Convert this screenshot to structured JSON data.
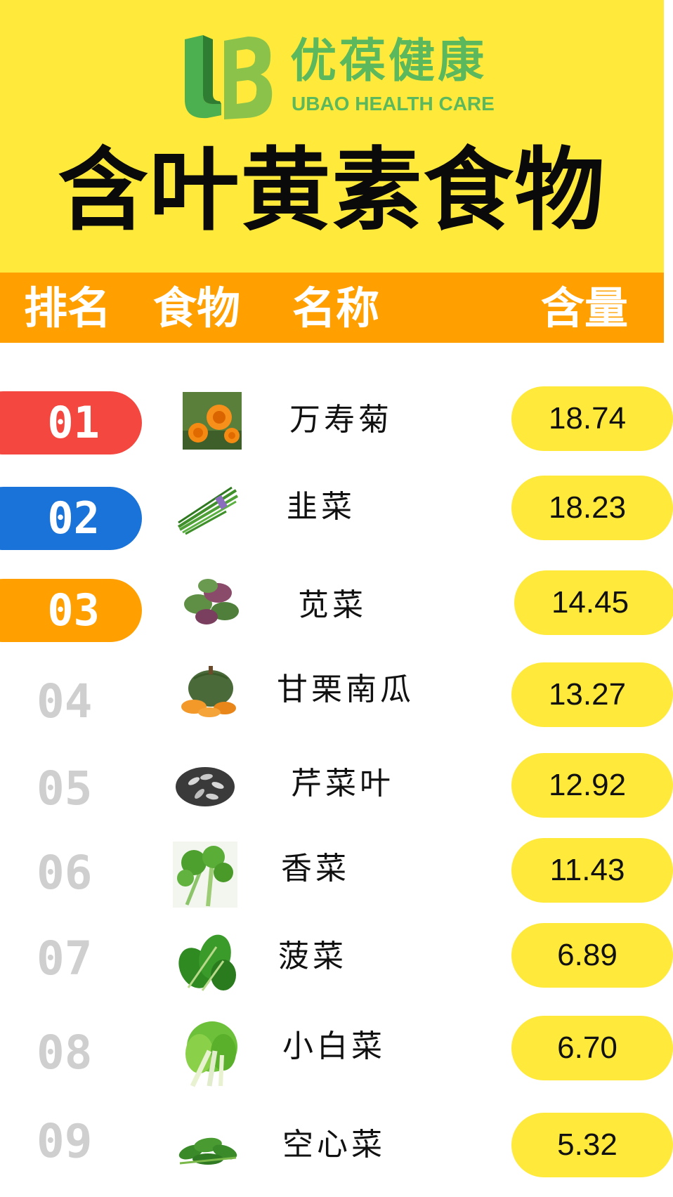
{
  "brand": {
    "name_cn": "优葆健康",
    "name_en": "UBAO HEALTH CARE"
  },
  "title": "含叶黄素食物",
  "header": {
    "rank": "排名",
    "food": "食物",
    "name": "名称",
    "amount": "含量"
  },
  "colors": {
    "background": "#ffe93a",
    "header": "#ffa000",
    "rank_1": "#f4473f",
    "rank_2": "#1a73d9",
    "rank_3": "#ffa000",
    "rank_other": "#cfcfcf",
    "value_pill": "#ffe93a",
    "brand": "#5cb85c"
  },
  "rows": [
    {
      "rank": "01",
      "name": "万寿菊",
      "value": "18.74",
      "image": "marigold-image"
    },
    {
      "rank": "02",
      "name": "韭菜",
      "value": "18.23",
      "image": "chives-image"
    },
    {
      "rank": "03",
      "name": "苋菜",
      "value": "14.45",
      "image": "amaranth-image"
    },
    {
      "rank": "04",
      "name": "甘栗南瓜",
      "value": "13.27",
      "image": "pumpkin-image"
    },
    {
      "rank": "05",
      "name": "芹菜叶",
      "value": "12.92",
      "image": "celery-leaf-image"
    },
    {
      "rank": "06",
      "name": "香菜",
      "value": "11.43",
      "image": "coriander-image"
    },
    {
      "rank": "07",
      "name": "菠菜",
      "value": "6.89",
      "image": "spinach-image"
    },
    {
      "rank": "08",
      "name": "小白菜",
      "value": "6.70",
      "image": "bok-choy-image"
    },
    {
      "rank": "09",
      "name": "空心菜",
      "value": "5.32",
      "image": "water-spinach-image"
    }
  ]
}
